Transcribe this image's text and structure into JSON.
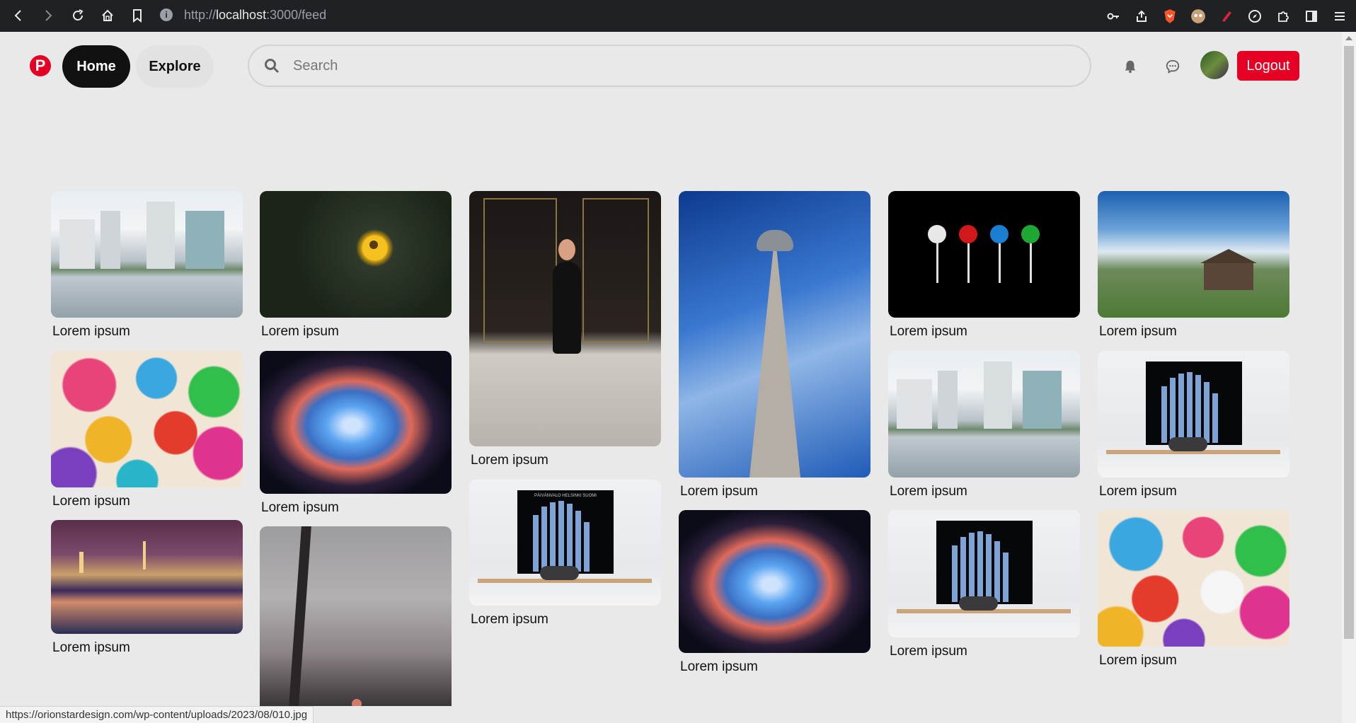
{
  "browser": {
    "url_prefix": "http://",
    "url_host": "localhost",
    "url_rest": ":3000/feed"
  },
  "header": {
    "logo": "P",
    "home_label": "Home",
    "explore_label": "Explore",
    "search_placeholder": "Search",
    "logout_label": "Logout"
  },
  "pins": [
    {
      "label": "Lorem ipsum",
      "image": "city-skyline-lake"
    },
    {
      "label": "Lorem ipsum",
      "image": "yellow-flower"
    },
    {
      "label": "Lorem ipsum",
      "image": "woman-black-dress"
    },
    {
      "label": "Lorem ipsum",
      "image": "cn-tower"
    },
    {
      "label": "Lorem ipsum",
      "image": "lollipops"
    },
    {
      "label": "Lorem ipsum",
      "image": "barn-field"
    },
    {
      "label": "Lorem ipsum",
      "image": "easter-eggs"
    },
    {
      "label": "Lorem ipsum",
      "image": "nebula"
    },
    {
      "label": "Lorem ipsum",
      "image": "chart-cat-desk"
    },
    {
      "label": "Lorem ipsum",
      "image": "city-skyline-lake"
    },
    {
      "label": "Lorem ipsum",
      "image": "chart-cat-desk"
    },
    {
      "label": "Lorem ipsum",
      "image": "prague-night"
    },
    {
      "label": "Lorem ipsum",
      "image": "nebula"
    },
    {
      "label": "Lorem ipsum",
      "image": "chart-cat-desk"
    },
    {
      "label": "Lorem ipsum",
      "image": "easter-eggs"
    },
    {
      "label": "",
      "image": "palm-sunset"
    }
  ],
  "chart_poster_title": "PÄIVÄNVALO HELSINKI SUOMI",
  "status_bar": "https://orionstardesign.com/wp-content/uploads/2023/08/010.jpg"
}
